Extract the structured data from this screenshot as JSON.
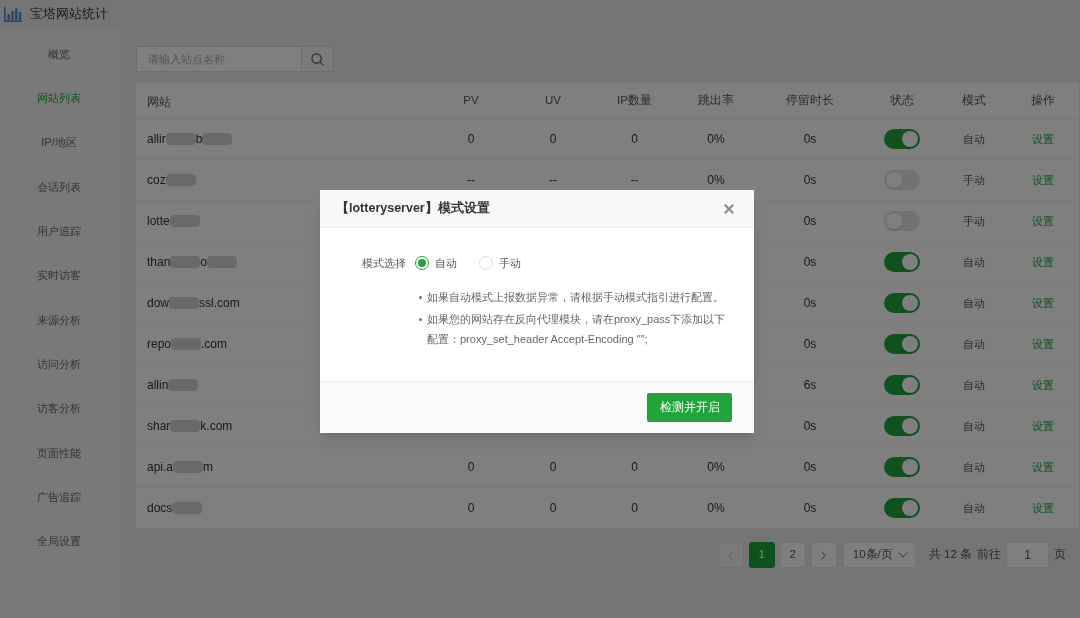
{
  "app": {
    "title": "宝塔网站统计"
  },
  "sidebar": {
    "items": [
      {
        "label": "概览",
        "selected": false
      },
      {
        "label": "网站列表",
        "selected": true
      },
      {
        "label": "IP/地区",
        "selected": false
      },
      {
        "label": "会话列表",
        "selected": false
      },
      {
        "label": "用户追踪",
        "selected": false
      },
      {
        "label": "实时访客",
        "selected": false
      },
      {
        "label": "来源分析",
        "selected": false
      },
      {
        "label": "访问分析",
        "selected": false
      },
      {
        "label": "访客分析",
        "selected": false
      },
      {
        "label": "页面性能",
        "selected": false
      },
      {
        "label": "广告追踪",
        "selected": false
      },
      {
        "label": "全局设置",
        "selected": false
      }
    ]
  },
  "search": {
    "placeholder": "请输入站点名称"
  },
  "table": {
    "columns": [
      "网站",
      "PV",
      "UV",
      "IP数量",
      "跳出率",
      "停留时长",
      "状态",
      "模式",
      "操作"
    ],
    "rows": [
      {
        "site": [
          {
            "kind": "text",
            "text": "allir"
          },
          {
            "kind": "blur"
          },
          {
            "kind": "text",
            "text": "b"
          },
          {
            "kind": "blur"
          }
        ],
        "pv": "0",
        "uv": "0",
        "ip": "0",
        "bounce": "0%",
        "stay": "0s",
        "on": true,
        "mode": "自动",
        "action": "设置"
      },
      {
        "site": [
          {
            "kind": "text",
            "text": "coz"
          },
          {
            "kind": "blur"
          }
        ],
        "pv": "--",
        "uv": "--",
        "ip": "--",
        "bounce": "0%",
        "stay": "0s",
        "on": false,
        "mode": "手动",
        "action": "设置"
      },
      {
        "site": [
          {
            "kind": "text",
            "text": "lotte"
          },
          {
            "kind": "blur"
          }
        ],
        "stay": "0s",
        "on": false,
        "mode": "手动",
        "action": "设置"
      },
      {
        "site": [
          {
            "kind": "text",
            "text": "than"
          },
          {
            "kind": "blur"
          },
          {
            "kind": "text",
            "text": "o"
          },
          {
            "kind": "blur"
          }
        ],
        "stay": "0s",
        "on": true,
        "mode": "自动",
        "action": "设置"
      },
      {
        "site": [
          {
            "kind": "text",
            "text": "dow"
          },
          {
            "kind": "blur"
          },
          {
            "kind": "text",
            "text": "ssl.com"
          }
        ],
        "stay": "0s",
        "on": true,
        "mode": "自动",
        "action": "设置"
      },
      {
        "site": [
          {
            "kind": "text",
            "text": "repo"
          },
          {
            "kind": "blur"
          },
          {
            "kind": "text",
            "text": ".com"
          }
        ],
        "stay": "0s",
        "on": true,
        "mode": "自动",
        "action": "设置"
      },
      {
        "site": [
          {
            "kind": "text",
            "text": "allin"
          },
          {
            "kind": "blur"
          }
        ],
        "stay": "6s",
        "on": true,
        "mode": "自动",
        "action": "设置"
      },
      {
        "site": [
          {
            "kind": "text",
            "text": "shar"
          },
          {
            "kind": "blur"
          },
          {
            "kind": "text",
            "text": "k.com"
          }
        ],
        "stay": "0s",
        "on": true,
        "mode": "自动",
        "action": "设置"
      },
      {
        "site": [
          {
            "kind": "text",
            "text": "api.a"
          },
          {
            "kind": "blur"
          },
          {
            "kind": "text",
            "text": "m"
          }
        ],
        "pv": "0",
        "uv": "0",
        "ip": "0",
        "bounce": "0%",
        "stay": "0s",
        "on": true,
        "mode": "自动",
        "action": "设置"
      },
      {
        "site": [
          {
            "kind": "text",
            "text": "docs"
          },
          {
            "kind": "blur"
          }
        ],
        "pv": "0",
        "uv": "0",
        "ip": "0",
        "bounce": "0%",
        "stay": "0s",
        "on": true,
        "mode": "自动",
        "action": "设置"
      }
    ]
  },
  "pagination": {
    "prev_disabled": true,
    "pages": [
      {
        "label": "1",
        "selected": true
      },
      {
        "label": "2",
        "selected": false
      }
    ],
    "next_disabled": false,
    "page_size": "10条/页",
    "total": "共 12 条",
    "goto_label": "前往",
    "goto_value": "1",
    "goto_suffix": "页"
  },
  "dialog": {
    "title": "【lotteryserver】模式设置",
    "field_label": "模式选择",
    "options": [
      {
        "label": "自动",
        "selected": true
      },
      {
        "label": "手动",
        "selected": false
      }
    ],
    "notes": [
      "如果自动模式上报数据异常，请根据手动模式指引进行配置。",
      "如果您的网站存在反向代理模块，请在proxy_pass下添加以下配置：proxy_set_header Accept-Encoding \"\";"
    ],
    "button": "检测并开启"
  }
}
